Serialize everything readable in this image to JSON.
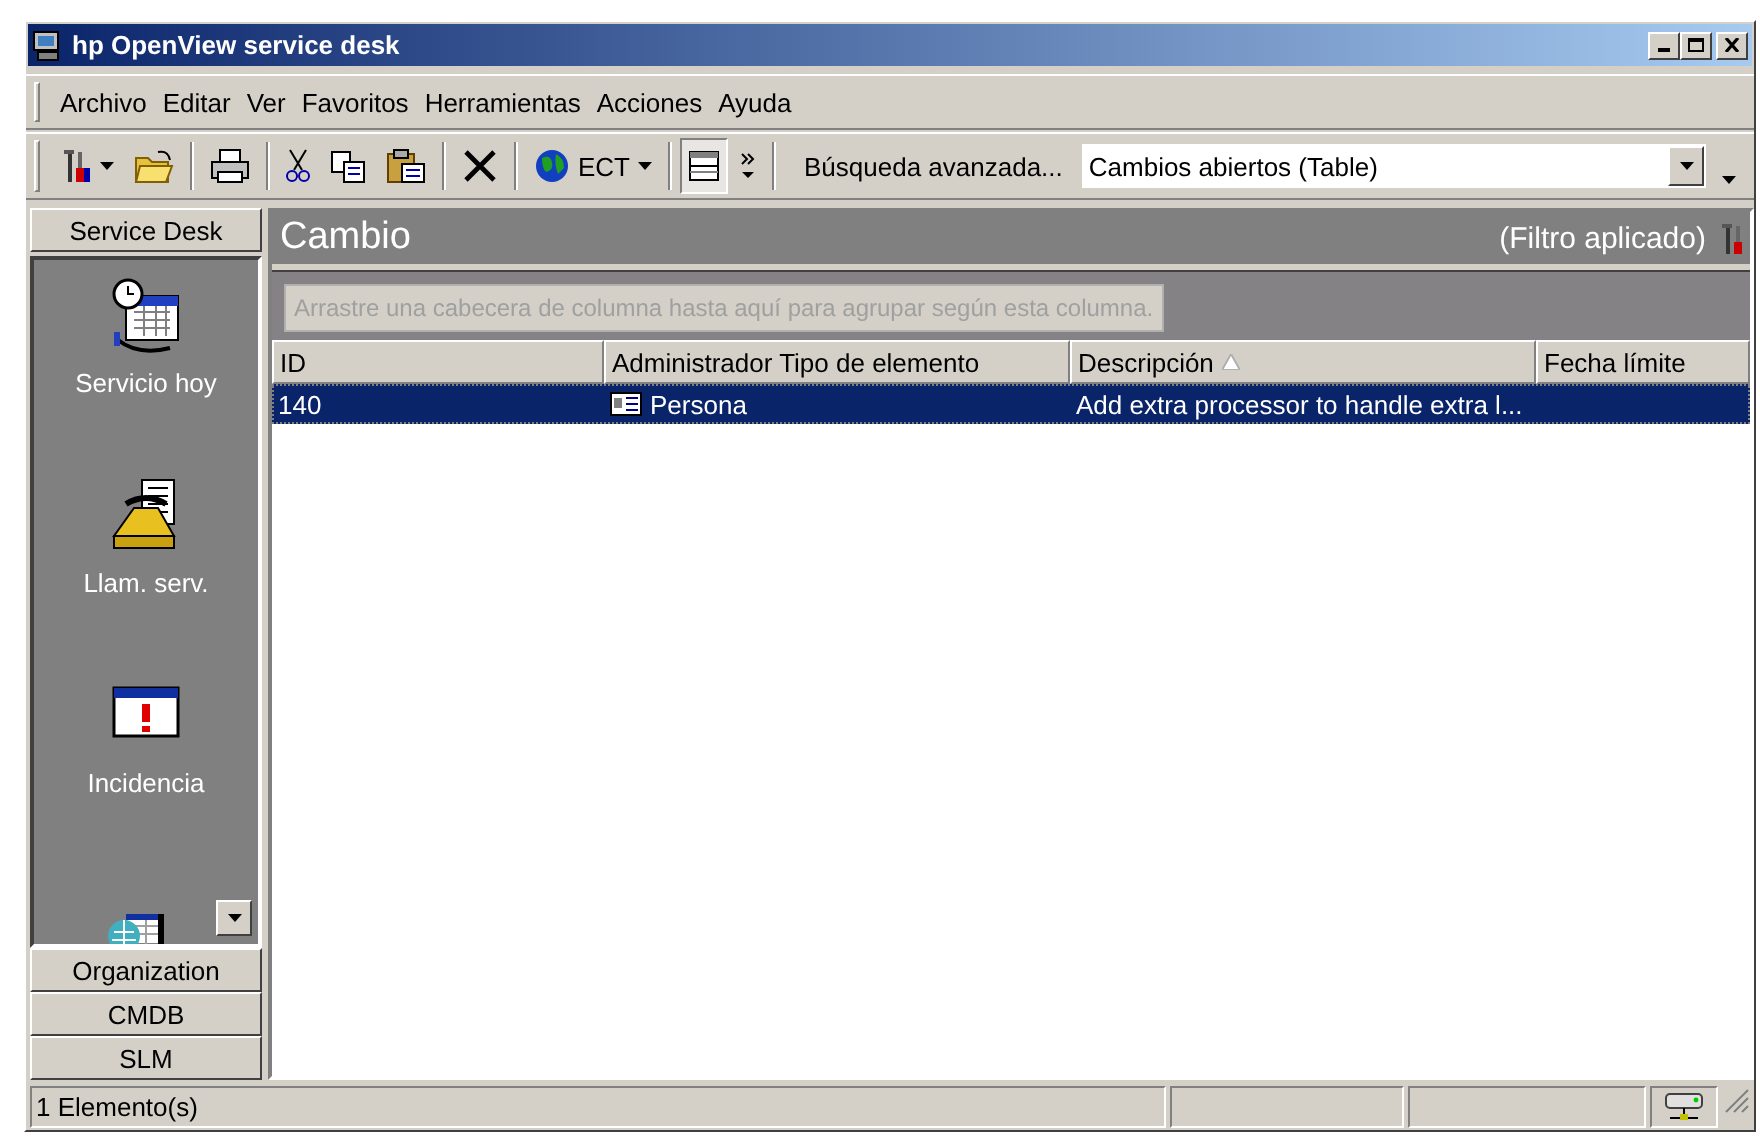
{
  "window": {
    "title": "hp OpenView service desk"
  },
  "menu": [
    "Archivo",
    "Editar",
    "Ver",
    "Favoritos",
    "Herramientas",
    "Acciones",
    "Ayuda"
  ],
  "toolbar": [
    {
      "kind": "tools",
      "dropdown": true,
      "pressed": false
    },
    {
      "kind": "open",
      "dropdown": false,
      "pressed": false
    },
    {
      "kind": "separator"
    },
    {
      "kind": "print",
      "dropdown": false,
      "pressed": false
    },
    {
      "kind": "separator"
    },
    {
      "kind": "cut",
      "dropdown": false,
      "pressed": false
    },
    {
      "kind": "copy",
      "dropdown": false,
      "pressed": false
    },
    {
      "kind": "paste",
      "dropdown": false,
      "pressed": false
    },
    {
      "kind": "separator"
    },
    {
      "kind": "delete",
      "dropdown": false,
      "pressed": false
    },
    {
      "kind": "separator"
    },
    {
      "kind": "globe",
      "label": "ECT",
      "dropdown": true,
      "pressed": false
    },
    {
      "kind": "separator"
    },
    {
      "kind": "layout",
      "dropdown": false,
      "pressed": true
    },
    {
      "kind": "more",
      "dropdown": false,
      "pressed": false
    }
  ],
  "search": {
    "label": "Búsqueda avanzada...",
    "view": "Cambios abiertos (Table)"
  },
  "sidebar": {
    "open_group": "Service Desk",
    "groups_below": [
      "Organization",
      "CMDB",
      "SLM"
    ],
    "items": [
      {
        "kind": "calendar",
        "label": "Servicio hoy"
      },
      {
        "kind": "phone",
        "label": "Llam. serv."
      },
      {
        "kind": "alert",
        "label": "Incidencia"
      },
      {
        "kind": "globe-table"
      }
    ]
  },
  "view": {
    "title": "Cambio",
    "filter": "(Filtro aplicado)",
    "group_hint": "Arrastre una cabecera de columna hasta aquí para agrupar según esta columna.",
    "columns": [
      {
        "label": "ID",
        "sorted": false
      },
      {
        "label": "Administrador Tipo de elemento",
        "sorted": false
      },
      {
        "label": "Descripción",
        "sorted": true
      },
      {
        "label": "Fecha límite",
        "sorted": false
      }
    ],
    "rows": [
      {
        "id": "140",
        "item_type": "Persona",
        "description": "Add extra processor to handle extra l...",
        "selected": true
      }
    ]
  },
  "status_bar": {
    "text": "1 Elemento(s)"
  }
}
